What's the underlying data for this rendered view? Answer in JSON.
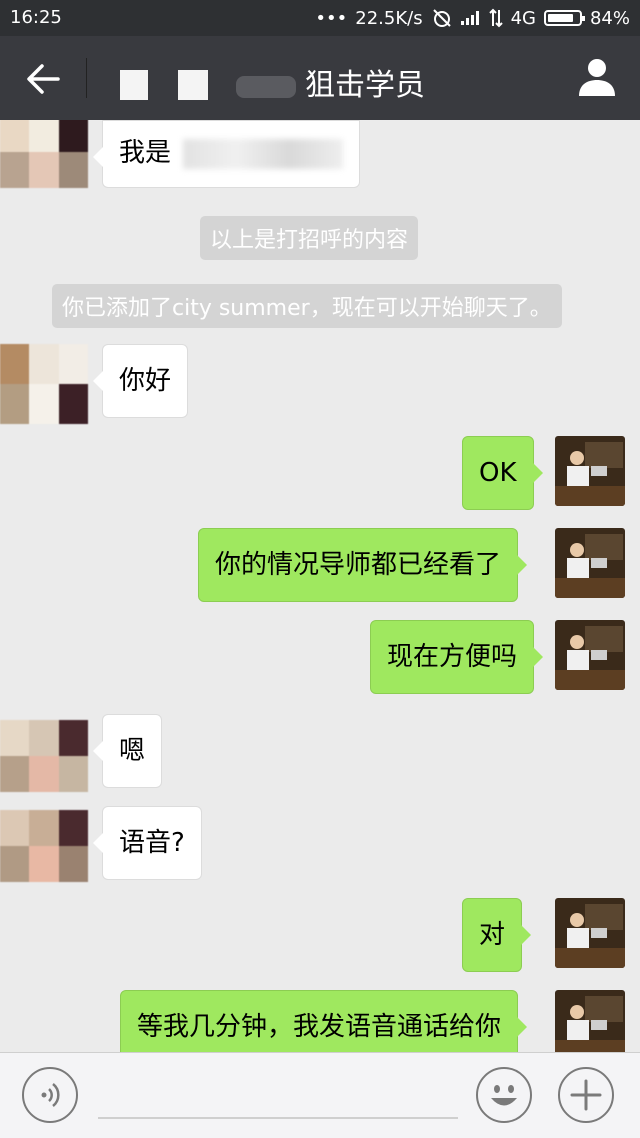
{
  "status_bar": {
    "time": "16:25",
    "dots": "•••",
    "speed": "22.5K/s",
    "network": "4G",
    "battery": "84%",
    "battery_level": 0.84
  },
  "title_bar": {
    "title": "狙击学员"
  },
  "system_messages": {
    "greeting_note": "以上是打招呼的内容",
    "added_note": "你已添加了city summer，现在可以开始聊天了。"
  },
  "messages": [
    {
      "side": "left",
      "text": "我是"
    },
    {
      "side": "left",
      "text": "你好"
    },
    {
      "side": "right",
      "text": "OK"
    },
    {
      "side": "right",
      "text": "你的情况导师都已经看了"
    },
    {
      "side": "right",
      "text": "现在方便吗"
    },
    {
      "side": "left",
      "text": "嗯"
    },
    {
      "side": "left",
      "text": "语音?"
    },
    {
      "side": "right",
      "text": "对"
    },
    {
      "side": "right",
      "text": "等我几分钟，我发语音通话给你"
    }
  ],
  "colors": {
    "title_bg": "#393a3f",
    "chat_bg": "#ebebeb",
    "sent_bubble": "#9fe85f",
    "received_bubble": "#ffffff"
  }
}
